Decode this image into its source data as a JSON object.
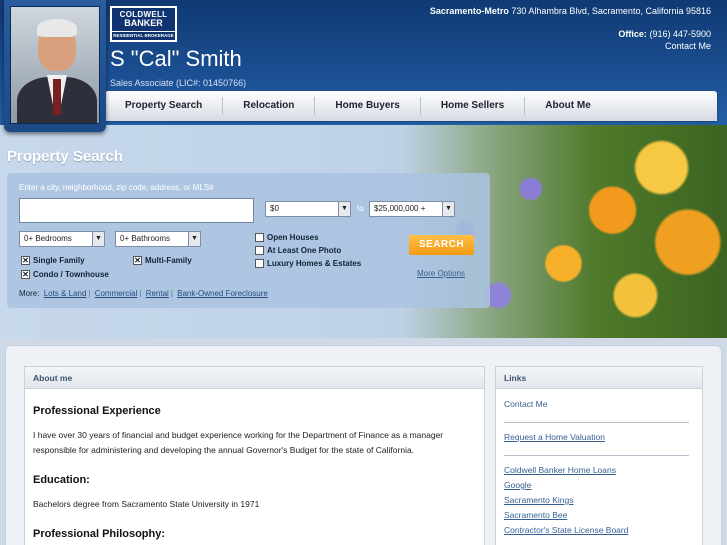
{
  "header": {
    "logo": {
      "line1": "COLDWELL",
      "line2": "BANKER",
      "line3": "RESIDENTIAL BROKERAGE"
    },
    "agent_name": "S \"Cal\" Smith",
    "agent_title": "Sales Associate (LIC#: 01450766)",
    "office_name": "Sacramento-Metro",
    "office_address": "730 Alhambra Blvd, Sacramento, California 95816",
    "office_label": "Office:",
    "office_phone": "(916) 447-5900",
    "contact_link": "Contact Me"
  },
  "nav": {
    "items": [
      "Property Search",
      "Relocation",
      "Home Buyers",
      "Home Sellers",
      "About Me"
    ]
  },
  "search": {
    "title": "Property Search",
    "hint": "Enter a city, neighborhood, zip code, address, or MLS#",
    "input_value": "",
    "price_min": "$0",
    "price_to_label": "to",
    "price_max": "$25,000,000 +",
    "beds": "0+ Bedrooms",
    "baths": "0+ Bathrooms",
    "checkboxes": {
      "open_houses": {
        "label": "Open Houses",
        "checked": false
      },
      "one_photo": {
        "label": "At Least One Photo",
        "checked": false
      },
      "luxury": {
        "label": "Luxury Homes & Estates",
        "checked": false
      },
      "single_family": {
        "label": "Single Family",
        "checked": true
      },
      "multi_family": {
        "label": "Multi-Family",
        "checked": true
      },
      "condo": {
        "label": "Condo / Townhouse",
        "checked": true
      }
    },
    "button": "SEARCH",
    "more_options": "More Options",
    "more_label": "More:",
    "more_links": [
      "Lots & Land",
      "Commercial",
      "Rental",
      "Bank-Owned Foreclosure"
    ]
  },
  "about": {
    "heading": "About me",
    "experience_title": "Professional Experience",
    "experience_text": "I have over 30 years of financial and budget experience working for the Department of Finance as a manager responsible for administering and developing the annual Governor's Budget for the state of California.",
    "education_title": "Education:",
    "education_text": "Bachelors degree from Sacramento State University in 1971",
    "philosophy_title": "Professional Philosophy:"
  },
  "links": {
    "heading": "Links",
    "contact": "Contact Me",
    "valuation": "Request a Home Valuation",
    "items": [
      "Coldwell Banker Home Loans",
      "Google",
      "Sacramento Kings",
      "Sacramento Bee",
      "Contractor's State License Board"
    ]
  }
}
